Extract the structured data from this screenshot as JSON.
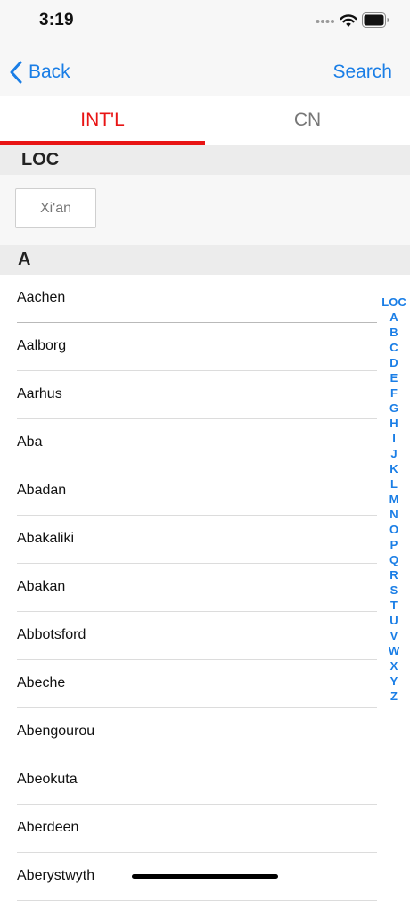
{
  "status_bar": {
    "time": "3:19"
  },
  "nav": {
    "back_label": "Back",
    "search_label": "Search"
  },
  "tabs": [
    {
      "label": "INT'L",
      "selected": true
    },
    {
      "label": "CN",
      "selected": false
    }
  ],
  "sections": {
    "loc_header": "LOC",
    "loc_city": "Xi'an",
    "a_header": "A"
  },
  "cities": [
    "Aachen",
    "Aalborg",
    "Aarhus",
    "Aba",
    "Abadan",
    "Abakaliki",
    "Abakan",
    "Abbotsford",
    "Abeche",
    "Abengourou",
    "Abeokuta",
    "Aberdeen",
    "Aberystwyth"
  ],
  "index": [
    "LOC",
    "A",
    "B",
    "C",
    "D",
    "E",
    "F",
    "G",
    "H",
    "I",
    "J",
    "K",
    "L",
    "M",
    "N",
    "O",
    "P",
    "Q",
    "R",
    "S",
    "T",
    "U",
    "V",
    "W",
    "X",
    "Y",
    "Z"
  ],
  "colors": {
    "accent": "#1a7ee6",
    "tab_selected": "#e81414",
    "tab_unselected": "#777777",
    "section_bg": "#ececec"
  }
}
